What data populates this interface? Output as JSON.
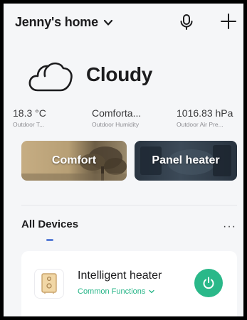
{
  "header": {
    "home_name": "Jenny's home",
    "icons": {
      "home_menu": "chevron-down-icon",
      "voice": "microphone-icon",
      "add": "plus-icon"
    }
  },
  "weather": {
    "condition": "Cloudy",
    "icon": "cloud-icon",
    "stats": [
      {
        "value": "18.3 °C",
        "label": "Outdoor T..."
      },
      {
        "value": "Comforta...",
        "label": "Outdoor Humidity"
      },
      {
        "value": "1016.83 hPa",
        "label": "Outdoor Air Pre..."
      }
    ]
  },
  "scenes": [
    {
      "title": "Comfort"
    },
    {
      "title": "Panel heater"
    }
  ],
  "devices_section": {
    "title": "All Devices",
    "more_label": "···",
    "accent": "#5b7fd6"
  },
  "devices": [
    {
      "name": "Intelligent heater",
      "link_label": "Common Functions",
      "power": "on",
      "power_color": "#2ab889",
      "icon": "heater-icon"
    }
  ]
}
